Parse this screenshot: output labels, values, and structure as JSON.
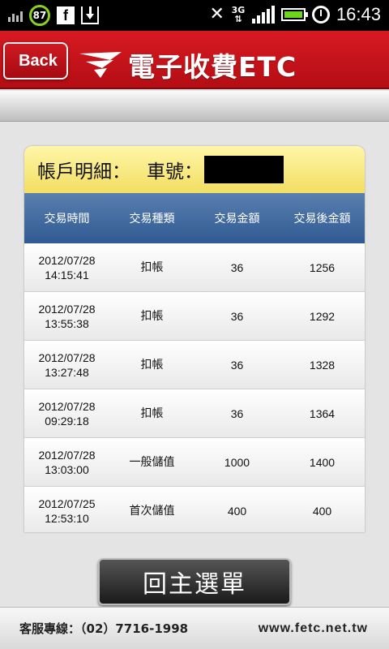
{
  "status_bar": {
    "notification_badge": "87",
    "network_type": "3G",
    "time": "16:43",
    "icons": [
      "signal-bars-icon",
      "facebook-icon",
      "download-icon",
      "mute-icon",
      "signal-strength-icon",
      "battery-icon",
      "alarm-icon"
    ],
    "battery_color": "#6cd61c"
  },
  "header": {
    "back_label": "Back",
    "title": "電子收費ETC",
    "brand_color": "#c8141c"
  },
  "card": {
    "account_label": "帳戶明細：",
    "plate_label": "車號："
  },
  "table": {
    "columns": [
      "交易時間",
      "交易種類",
      "交易金額",
      "交易後金額"
    ],
    "header_color": "#3d6699",
    "rows": [
      {
        "date": "2012/07/28",
        "time": "14:15:41",
        "type": "扣帳",
        "amount": "36",
        "balance": "1256"
      },
      {
        "date": "2012/07/28",
        "time": "13:55:38",
        "type": "扣帳",
        "amount": "36",
        "balance": "1292"
      },
      {
        "date": "2012/07/28",
        "time": "13:27:48",
        "type": "扣帳",
        "amount": "36",
        "balance": "1328"
      },
      {
        "date": "2012/07/28",
        "time": "09:29:18",
        "type": "扣帳",
        "amount": "36",
        "balance": "1364"
      },
      {
        "date": "2012/07/28",
        "time": "13:03:00",
        "type": "一般儲值",
        "amount": "1000",
        "balance": "1400"
      },
      {
        "date": "2012/07/25",
        "time": "12:53:10",
        "type": "首次儲值",
        "amount": "400",
        "balance": "400"
      }
    ]
  },
  "main_menu_label": "回主選單",
  "footer": {
    "hotline": "客服專線：（02）7716-1998",
    "website": "www.fetc.net.tw"
  }
}
